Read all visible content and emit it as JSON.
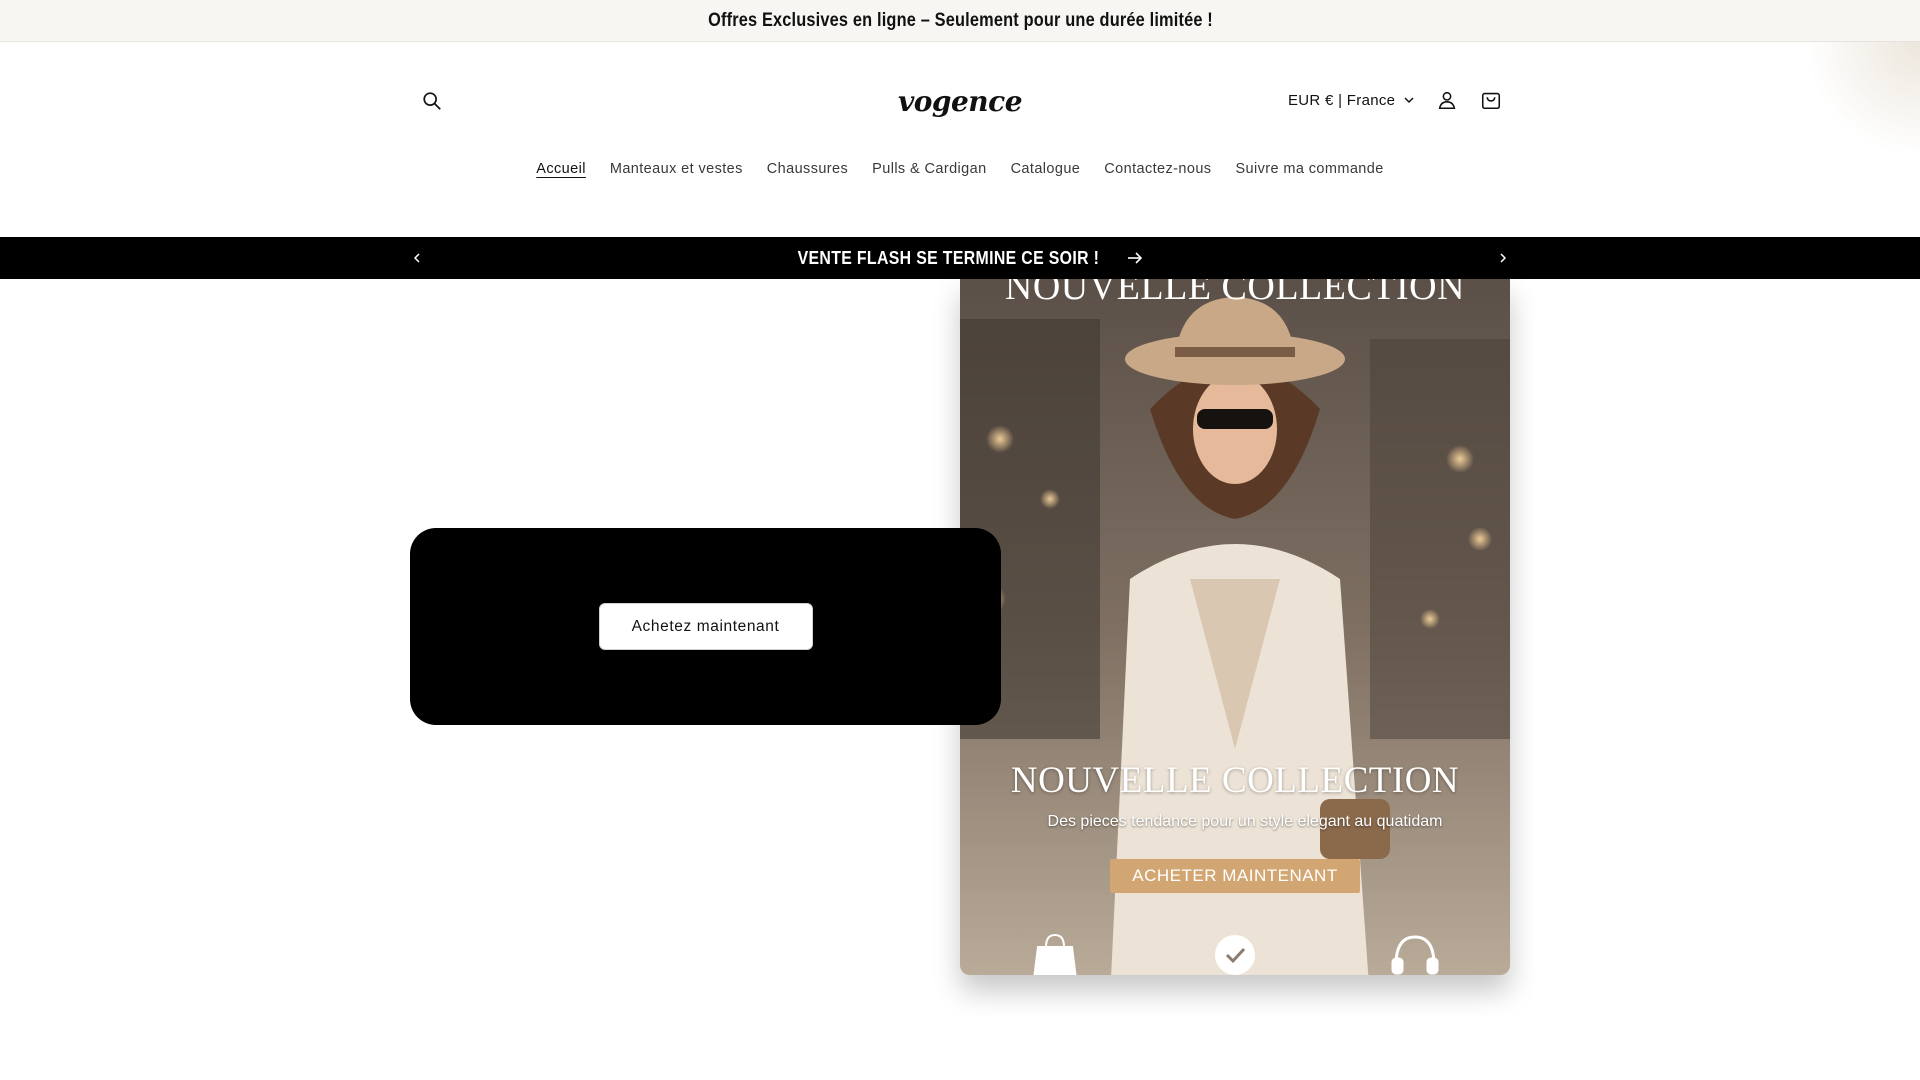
{
  "announcement": {
    "text": "Offres Exclusives en ligne – Seulement pour une durée limitée !"
  },
  "header": {
    "logo": "vogence",
    "currency": "EUR € | France",
    "icons": {
      "search": "search-icon",
      "account": "user-icon",
      "cart": "bag-icon"
    }
  },
  "nav": {
    "items": [
      {
        "label": "Accueil",
        "active": true
      },
      {
        "label": "Manteaux et vestes"
      },
      {
        "label": "Chaussures"
      },
      {
        "label": "Pulls & Cardigan"
      },
      {
        "label": "Catalogue"
      },
      {
        "label": "Contactez-nous"
      },
      {
        "label": "Suivre ma commande"
      }
    ]
  },
  "promo_bar": {
    "message": "VENTE FLASH SE TERMINE CE SOIR !"
  },
  "hero": {
    "button_label": "Achetez maintenant"
  },
  "banner": {
    "title_top": "NOUVELLE COLLECTION",
    "title": "NOUVELLE COLLECTION",
    "subtitle": "Des pieces tendance pour un style elegant au quatidam",
    "cta": "ACHETER MAINTENANT",
    "icons": [
      "shopping-bag-icon",
      "badge-icon",
      "headset-icon"
    ]
  },
  "colors": {
    "promo_bar": "#000000",
    "cta_gold": "#d2a672",
    "announce_bg": "#f8f6f2"
  }
}
